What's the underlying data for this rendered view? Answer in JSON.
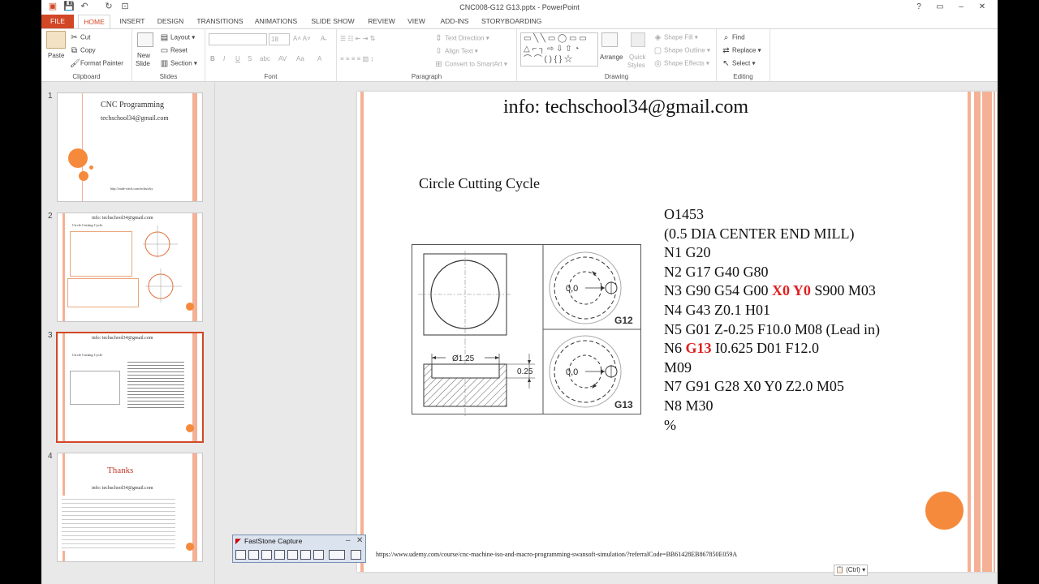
{
  "window": {
    "title": "CNC008-G12 G13.pptx - PowerPoint",
    "min": "–",
    "max": "□",
    "close": "✕"
  },
  "tabs": [
    "FILE",
    "HOME",
    "INSERT",
    "DESIGN",
    "TRANSITIONS",
    "ANIMATIONS",
    "SLIDE SHOW",
    "REVIEW",
    "VIEW",
    "ADD-INS",
    "STORYBOARDING"
  ],
  "ribbon": {
    "clipboard": {
      "label": "Clipboard",
      "paste": "Paste",
      "cut": "Cut",
      "copy": "Copy",
      "format_painter": "Format Painter"
    },
    "slides": {
      "label": "Slides",
      "new_slide": "New",
      "new_slide2": "Slide",
      "layout": "Layout",
      "reset": "Reset",
      "section": "Section"
    },
    "font": {
      "label": "Font",
      "size": "18"
    },
    "paragraph": {
      "label": "Paragraph",
      "text_direction": "Text Direction",
      "align_text": "Align Text",
      "smartart": "Convert to SmartArt"
    },
    "drawing": {
      "label": "Drawing",
      "arrange": "Arrange",
      "quick_styles": "Quick",
      "quick_styles2": "Styles",
      "shape_fill": "Shape Fill",
      "shape_outline": "Shape Outline",
      "shape_effects": "Shape Effects"
    },
    "editing": {
      "label": "Editing",
      "find": "Find",
      "replace": "Replace",
      "select": "Select"
    }
  },
  "thumbnails": {
    "s1": {
      "num": "1",
      "title": "CNC Programming",
      "email": "techschool34@gmail.com",
      "link": "http://trade-ctech.com/techsocky"
    },
    "s2": {
      "num": "2",
      "title": "info: techschool34@gmail.com",
      "subtitle": "Circle Cutting Cycle"
    },
    "s3": {
      "num": "3",
      "title": "info: techschool34@gmail.com",
      "subtitle": "Circle Cutting Cycle"
    },
    "s4": {
      "num": "4",
      "title": "Thanks",
      "email": "info: techschool34@gmail.com"
    }
  },
  "slide": {
    "header": "info: techschool34@gmail.com",
    "subtitle": "Circle Cutting Cycle",
    "code": {
      "l1": "O1453",
      "l2": "(0.5 DIA CENTER END MILL)",
      "l3": "N1 G20",
      "l4": "N2 G17 G40 G80",
      "l5a": "N3 G90 G54 G00 ",
      "l5b": "X0 Y0",
      "l5c": " S900 M03",
      "l6": "N4 G43 Z0.1 H01",
      "l7": "N5 G01 Z-0.25 F10.0 M08 (Lead in)",
      "l8a": "N6 ",
      "l8b": "G13",
      "l8c": " I0.625 D01 F12.0",
      "l9": "M09",
      "l10": "N7 G91 G28 X0 Y0 Z2.0 M05",
      "l11": "N8 M30",
      "l12": "%"
    },
    "drawing": {
      "dia": "Ø1.25",
      "depth": "0.25",
      "center": "0,0",
      "center2": "0,0",
      "g12": "G12",
      "g13": "G13"
    },
    "url": "https://www.udemy.com/course/cnc-machine-iso-and-macro-programming-swansoft-simulation/?referralCode=BB61428EB867850E059A"
  },
  "fastcapture": {
    "title": "FastStone Capture"
  },
  "paste_options": "(Ctrl)"
}
